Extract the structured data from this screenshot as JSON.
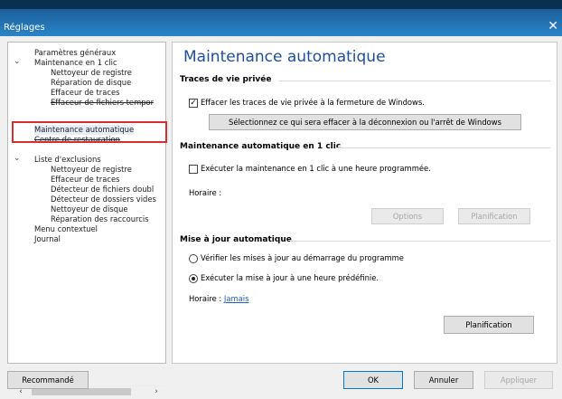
{
  "window": {
    "title": "Réglages"
  },
  "sidebar": {
    "items": [
      {
        "label": "Paramètres généraux",
        "level": 0,
        "expand": false
      },
      {
        "label": "Maintenance en 1 clic",
        "level": 0,
        "expand": true
      },
      {
        "label": "Nettoyeur de registre",
        "level": 1
      },
      {
        "label": "Réparation de disque",
        "level": 1
      },
      {
        "label": "Effaceur de traces",
        "level": 1
      },
      {
        "label": "Effaceur de fichiers tempor",
        "level": 1
      },
      {
        "label": "Maintenance automatique",
        "level": 0,
        "selected": true
      },
      {
        "label": "Centre de restauration",
        "level": 0
      },
      {
        "label": "Liste d'exclusions",
        "level": 0,
        "expand": true
      },
      {
        "label": "Nettoyeur de registre",
        "level": 1
      },
      {
        "label": "Effaceur de traces",
        "level": 1
      },
      {
        "label": "Détecteur de fichiers doubl",
        "level": 1
      },
      {
        "label": "Détecteur de dossiers vides",
        "level": 1
      },
      {
        "label": "Nettoyeur de disque",
        "level": 1
      },
      {
        "label": "Réparation des raccourcis",
        "level": 1
      },
      {
        "label": "Menu contextuel",
        "level": 0
      },
      {
        "label": "Journal",
        "level": 0
      }
    ],
    "scroll_left": "‹",
    "scroll_right": "›"
  },
  "main": {
    "title": "Maintenance automatique",
    "privacy": {
      "heading": "Traces de vie privée",
      "checkbox_label": "Effacer les traces de vie privée à la fermeture de Windows.",
      "checked": true,
      "select_button": "Sélectionnez ce qui sera effacer à la déconnexion ou l'arrêt de Windows"
    },
    "oneclick": {
      "heading": "Maintenance automatique en 1 clic",
      "checkbox_label": "Exécuter la maintenance en 1 clic à une heure programmée.",
      "checked": false,
      "schedule_label": "Horaire :",
      "options_button": "Options",
      "planning_button": "Planification"
    },
    "update": {
      "heading": "Mise à jour automatique",
      "radio1": "Vérifier les mises à jour au démarrage du programme",
      "radio2": "Exécuter la mise à jour à une heure prédéfinie.",
      "selected_radio": 2,
      "schedule_label": "Horaire :",
      "schedule_value": "Jamais",
      "planning_button": "Planification"
    }
  },
  "footer": {
    "recommended": "Recommandé",
    "ok": "OK",
    "cancel": "Annuler",
    "apply": "Appliquer"
  },
  "colors": {
    "accent": "#1f4e9c",
    "selection_border": "#d72f2f",
    "titlebar": "#2a84c8"
  }
}
